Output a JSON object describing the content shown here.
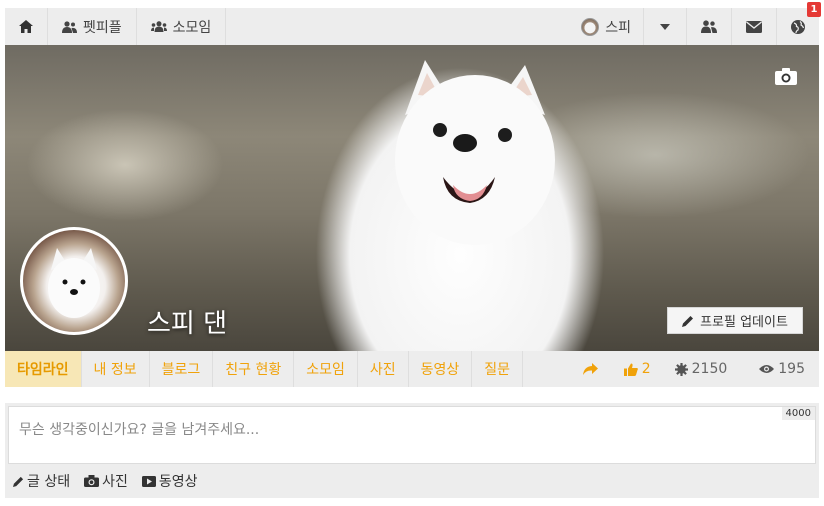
{
  "nav": {
    "home_icon": "home-icon",
    "petpeople_label": "펫피플",
    "club_label": "소모임",
    "user_label": "스피",
    "notification_count": "1"
  },
  "cover": {
    "profile_name": "스피 댄",
    "update_button_label": "프로필 업데이트"
  },
  "tabs": [
    "타임라인",
    "내 정보",
    "블로그",
    "친구 현황",
    "소모임",
    "사진",
    "동영상",
    "질문"
  ],
  "stats": {
    "likes": "2",
    "points": "2150",
    "views": "195"
  },
  "composer": {
    "placeholder": "무슨 생각중이신가요? 글을 남겨주세요...",
    "char_limit": "4000",
    "status_label": "글 상태",
    "photo_label": "사진",
    "video_label": "동영상"
  },
  "colors": {
    "accent": "#f0a20a",
    "active_tab_bg": "#f7e7b6",
    "badge": "#e53935"
  }
}
